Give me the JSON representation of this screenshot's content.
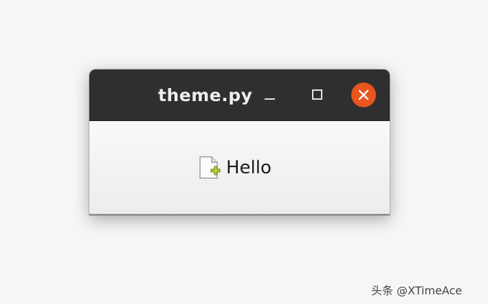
{
  "window": {
    "title": "theme.py"
  },
  "titlebar_controls": {
    "minimize_icon": "minimize-icon",
    "maximize_icon": "maximize-icon",
    "close_icon": "close-icon",
    "close_color": "#e9541f"
  },
  "content": {
    "label_text": "Hello",
    "label_icon": "document-new-icon"
  },
  "watermark": "头条 @XTimeAce"
}
